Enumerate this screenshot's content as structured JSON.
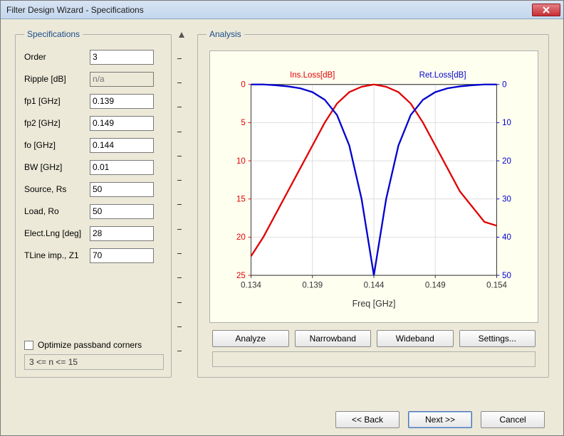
{
  "window": {
    "title": "Filter Design Wizard - Specifications"
  },
  "specs": {
    "legend": "Specifications",
    "fields": [
      {
        "label": "Order",
        "value": "3",
        "disabled": false
      },
      {
        "label": "Ripple [dB]",
        "value": "n/a",
        "disabled": true
      },
      {
        "label": "fp1 [GHz]",
        "value": "0.139",
        "disabled": false
      },
      {
        "label": "fp2 [GHz]",
        "value": "0.149",
        "disabled": false
      },
      {
        "label": "fo [GHz]",
        "value": "0.144",
        "disabled": false
      },
      {
        "label": "BW [GHz]",
        "value": "0.01",
        "disabled": false
      },
      {
        "label": "Source, Rs",
        "value": "50",
        "disabled": false
      },
      {
        "label": "Load, Ro",
        "value": "50",
        "disabled": false
      },
      {
        "label": "Elect.Lng [deg]",
        "value": "28",
        "disabled": false
      },
      {
        "label": "TLine imp., Z1",
        "value": "70",
        "disabled": false
      }
    ],
    "optimize_label": "Optimize passband corners",
    "optimize_checked": false,
    "order_range": "3 <= n <= 15"
  },
  "analysis": {
    "legend": "Analysis",
    "buttons": {
      "analyze": "Analyze",
      "narrowband": "Narrowband",
      "wideband": "Wideband",
      "settings": "Settings..."
    }
  },
  "chart_data": {
    "type": "line",
    "title": "",
    "xlabel": "Freq [GHz]",
    "x_ticks": [
      0.134,
      0.139,
      0.144,
      0.149,
      0.154
    ],
    "series": [
      {
        "name": "Ins.Loss[dB]",
        "color": "#e00000",
        "axis": "left",
        "x": [
          0.134,
          0.135,
          0.136,
          0.137,
          0.138,
          0.139,
          0.14,
          0.141,
          0.142,
          0.143,
          0.144,
          0.145,
          0.146,
          0.147,
          0.148,
          0.149,
          0.15,
          0.151,
          0.152,
          0.153,
          0.154
        ],
        "y": [
          22.5,
          20,
          17,
          14,
          11,
          8,
          5,
          2.5,
          1,
          0.3,
          0,
          0.3,
          1,
          2.5,
          5,
          8,
          11,
          14,
          16,
          18,
          18.5
        ]
      },
      {
        "name": "Ret.Loss[dB]",
        "color": "#0000d0",
        "axis": "right",
        "x": [
          0.134,
          0.135,
          0.136,
          0.137,
          0.138,
          0.139,
          0.14,
          0.141,
          0.142,
          0.143,
          0.144,
          0.145,
          0.146,
          0.147,
          0.148,
          0.149,
          0.15,
          0.151,
          0.152,
          0.153,
          0.154
        ],
        "y": [
          0,
          0,
          0.2,
          0.5,
          1,
          2,
          4,
          8,
          16,
          30,
          50,
          30,
          16,
          8,
          4,
          2,
          1,
          0.5,
          0.2,
          0,
          0
        ]
      }
    ],
    "axes": {
      "left": {
        "label": "Ins.Loss[dB]",
        "ticks": [
          0,
          5,
          10,
          15,
          20,
          25
        ],
        "color": "#e00000"
      },
      "right": {
        "label": "Ret.Loss[dB]",
        "ticks": [
          0,
          10,
          20,
          30,
          40,
          50
        ],
        "color": "#0000d0"
      }
    }
  },
  "footer": {
    "back": "<< Back",
    "next": "Next >>",
    "cancel": "Cancel"
  }
}
